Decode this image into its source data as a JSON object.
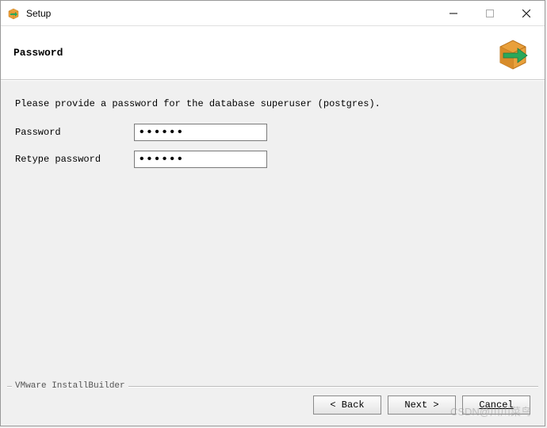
{
  "titlebar": {
    "title": "Setup"
  },
  "header": {
    "title": "Password"
  },
  "content": {
    "instruction": "Please provide a password for the database superuser (postgres).",
    "password_label": "Password",
    "retype_label": "Retype password",
    "password_value": "••••••",
    "retype_value": "••••••"
  },
  "footer": {
    "branding": "VMware InstallBuilder",
    "back_label": "< Back",
    "next_label": "Next >",
    "cancel_label": "Cancel"
  },
  "watermark": "CSDN@川川菜鸟",
  "colors": {
    "box_orange": "#e9a03b",
    "arrow_green": "#2aa85a"
  }
}
